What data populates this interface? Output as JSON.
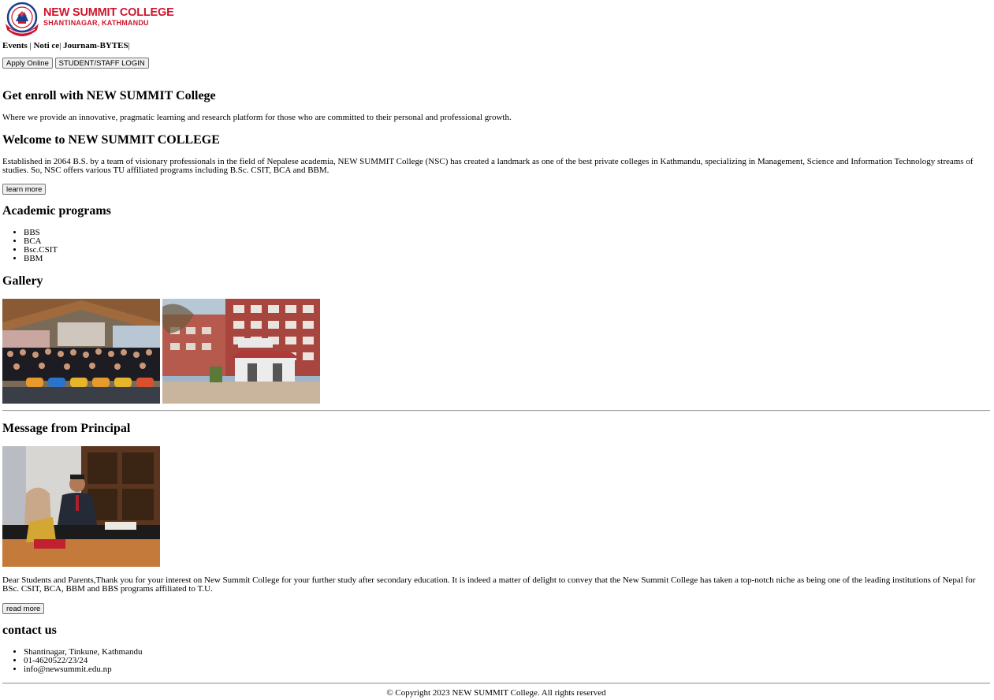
{
  "header": {
    "logo_name": "NEW SUMMIT COLLEGE",
    "logo_sub": "SHANTINAGAR, KATHMANDU",
    "nav": [
      {
        "label": "Events"
      },
      {
        "label": "Noti ce"
      },
      {
        "label": "Journam-BYTES"
      }
    ],
    "apply_button": "Apply Online",
    "login_button": "STUDENT/STAFF LOGIN"
  },
  "hero": {
    "title": "Get enroll with NEW SUMMIT College",
    "tagline": "Where we provide an innovative, pragmatic learning and research platform for those who are committed to their personal and professional growth."
  },
  "welcome": {
    "title": "Welcome to NEW SUMMIT COLLEGE",
    "body": "Established in 2064 B.S. by a team of visionary professionals in the field of Nepalese academia, NEW SUMMIT College (NSC) has created a landmark as one of the best private colleges in Kathmandu, specializing in Management, Science and Information Technology streams of studies. So, NSC offers various TU affiliated programs including B.Sc. CSIT, BCA and BBM.",
    "button": "learn more"
  },
  "programs": {
    "title": "Academic programs",
    "items": [
      "BBS",
      "BCA",
      "Bsc.CSIT",
      "BBM"
    ]
  },
  "gallery": {
    "title": "Gallery"
  },
  "principal": {
    "title": "Message from Principal",
    "body": "Dear Students and Parents,Thank you for your interest on New Summit College for your further study after secondary education. It is indeed a matter of delight to convey that the New Summit College has taken a top-notch niche as being one of the leading institutions of Nepal for BSc. CSIT, BCA, BBM and BBS programs affiliated to T.U.",
    "button": "read more"
  },
  "contact": {
    "title": "contact us",
    "items": [
      "Shantinagar, Tinkune, Kathmandu",
      "01-4620522/23/24",
      "info@newsummit.edu.np"
    ]
  },
  "footer": {
    "copyright": "© Copyright 2023 NEW SUMMIT College. All rights reserved"
  },
  "colors": {
    "brand_red": "#d0142b",
    "brand_blue": "#1b3f8f"
  }
}
